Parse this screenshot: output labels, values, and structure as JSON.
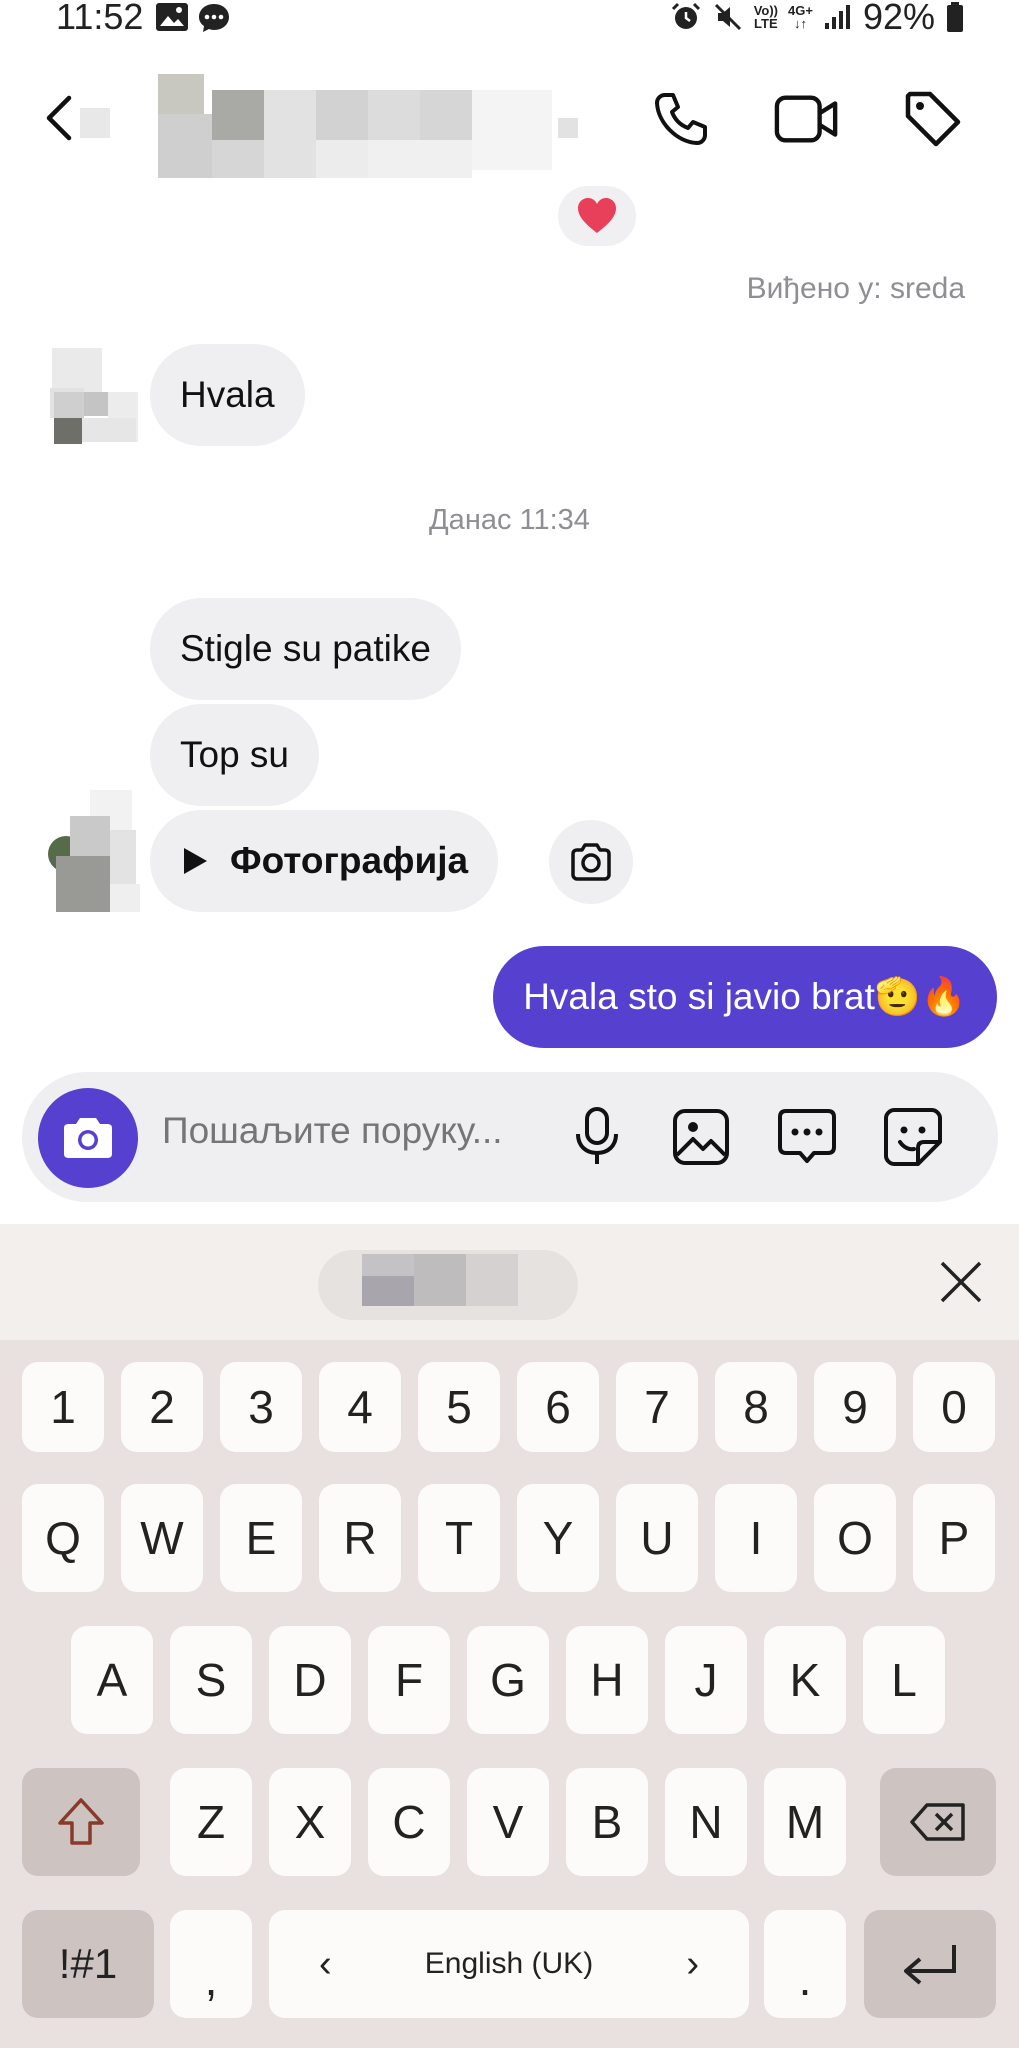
{
  "status_bar": {
    "time": "11:52",
    "battery": "92%",
    "volte": "Vo))",
    "lte": "LTE",
    "net": "4G+"
  },
  "header": {
    "back_icon": "chevron-left-icon",
    "call_icon": "phone-icon",
    "video_icon": "video-camera-icon",
    "tag_icon": "tag-icon"
  },
  "chat": {
    "reaction": "❤️",
    "seen": "Виђено у: sreda",
    "msg_hvala": "Hvala",
    "date_separator": "Данас 11:34",
    "msg_stigle": "Stigle su patike",
    "msg_top": "Top su",
    "photo_label": "Фотографија",
    "outgoing": "Hvala sto si javio brat🫡🔥"
  },
  "composer": {
    "placeholder": "Пошаљите поруку..."
  },
  "keyboard": {
    "row_numbers": [
      "1",
      "2",
      "3",
      "4",
      "5",
      "6",
      "7",
      "8",
      "9",
      "0"
    ],
    "row_q": [
      "Q",
      "W",
      "E",
      "R",
      "T",
      "Y",
      "U",
      "I",
      "O",
      "P"
    ],
    "row_a": [
      "A",
      "S",
      "D",
      "F",
      "G",
      "H",
      "J",
      "K",
      "L"
    ],
    "row_z": [
      "Z",
      "X",
      "C",
      "V",
      "B",
      "N",
      "M"
    ],
    "symbols": "!#1",
    "comma": ",",
    "language": "English (UK)",
    "period": ".",
    "space_left": "‹",
    "space_right": "›"
  },
  "colors": {
    "accent": "#5540cf",
    "bubble_incoming": "#efeff1",
    "keyboard_bg": "#e8e1df"
  }
}
